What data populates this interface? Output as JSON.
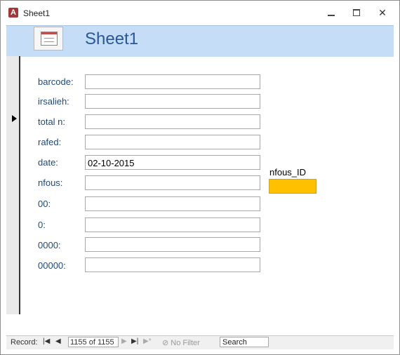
{
  "window": {
    "title": "Sheet1",
    "app_icon": "A",
    "close_glyph": "✕"
  },
  "form": {
    "title": "Sheet1"
  },
  "fields": [
    {
      "label": "barcode:",
      "value": ""
    },
    {
      "label": "irsalieh:",
      "value": ""
    },
    {
      "label": "total n:",
      "value": ""
    },
    {
      "label": "rafed:",
      "value": ""
    },
    {
      "label": "date:",
      "value": "02-10-2015"
    },
    {
      "label": "nfous:",
      "value": ""
    },
    {
      "label": "00:",
      "value": ""
    },
    {
      "label": "0:",
      "value": ""
    },
    {
      "label": "0000:",
      "value": ""
    },
    {
      "label": "00000:",
      "value": ""
    }
  ],
  "nfous_id": {
    "label": "nfous_ID",
    "color": "#ffc000"
  },
  "navigation": {
    "record_label": "Record:",
    "first_glyph": "|◀",
    "prev_glyph": "◀",
    "current": "1155 of 1155",
    "next_glyph": "▶",
    "last_glyph": "▶|",
    "new_glyph": "▶*",
    "filter_icon": "⊘",
    "filter_label": "No Filter",
    "search_value": "Search"
  },
  "colors": {
    "header_bg": "#c5ddf6",
    "title_color": "#2b5797",
    "label_color": "#1f497d"
  }
}
